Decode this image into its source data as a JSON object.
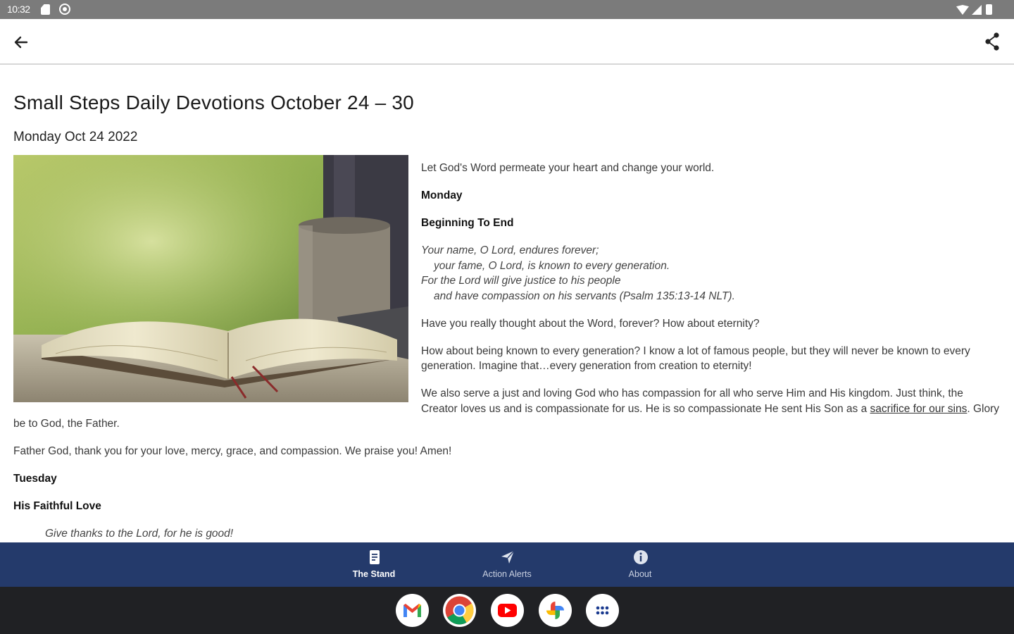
{
  "status_bar": {
    "time": "10:32"
  },
  "app_bar": {
    "back_icon": "arrow-left-icon",
    "share_icon": "share-icon"
  },
  "article": {
    "title": "Small Steps Daily Devotions October 24 – 30",
    "date": "Monday Oct 24 2022",
    "intro": "Let God's Word permeate your heart and change your world.",
    "day_monday": "Monday",
    "heading_monday": "Beginning To End",
    "verse_lines": [
      "Your name, O Lord, endures forever;",
      "your fame, O Lord, is known to every generation.",
      "For the Lord will give justice to his people",
      "and have compassion on his servants (Psalm 135:13-14 NLT)."
    ],
    "para1": "Have you really thought about the Word, forever? How about eternity?",
    "para2": "How about being known to every generation? I know a lot of famous people, but they will never be known to every generation. Imagine that…every generation from creation to eternity!",
    "para3_text": "We also serve a just and loving God who has compassion for all who serve Him and His kingdom. Just think, the Creator loves us and is compassionate for us. He is so compassionate He sent His Son as a ",
    "para3_link": "sacrifice for our sins",
    "para3_tail": ". Glory be to God, the Father.",
    "prayer": "Father God, thank you for your love, mercy, grace, and compassion. We praise you! Amen!",
    "day_tuesday": "Tuesday",
    "heading_tuesday": "His Faithful Love",
    "verse_tuesday": "Give thanks to the Lord, for he is good!"
  },
  "bottom_nav": {
    "items": [
      {
        "label": "The Stand",
        "icon": "document-icon",
        "active": true
      },
      {
        "label": "Action Alerts",
        "icon": "send-icon",
        "active": false
      },
      {
        "label": "About",
        "icon": "info-icon",
        "active": false
      }
    ]
  },
  "dock": {
    "apps": [
      "gmail-icon",
      "chrome-icon",
      "youtube-icon",
      "photos-icon",
      "app-drawer-icon"
    ]
  },
  "colors": {
    "nav_background": "#243a6b",
    "status_bar": "#7b7b7b",
    "dock_background": "#202124"
  }
}
